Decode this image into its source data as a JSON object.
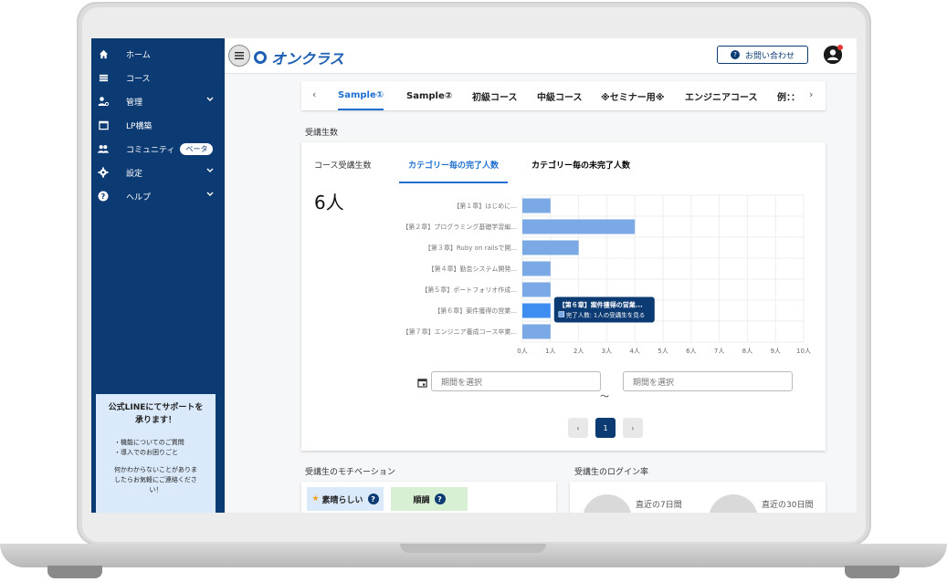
{
  "sidebar": {
    "items": [
      {
        "label": "ホーム",
        "icon": "home-icon",
        "has_chevron": false
      },
      {
        "label": "コース",
        "icon": "list-icon",
        "has_chevron": false
      },
      {
        "label": "管理",
        "icon": "user-gear-icon",
        "has_chevron": true
      },
      {
        "label": "LP構築",
        "icon": "window-icon",
        "has_chevron": false
      },
      {
        "label": "コミュニティ",
        "icon": "group-icon",
        "has_chevron": false,
        "badge": "ベータ"
      },
      {
        "label": "設定",
        "icon": "gear-icon",
        "has_chevron": true
      },
      {
        "label": "ヘルプ",
        "icon": "help-icon",
        "has_chevron": true
      }
    ],
    "support": {
      "title_line1": "公式LINEにてサポートを",
      "title_line2": "承ります！",
      "bullets": [
        "・機能についてのご質問",
        "・導入でのお困りごと"
      ],
      "note_line1": "何かわからないことがありま",
      "note_line2": "したらお気軽にご連絡くださ",
      "note_line3": "い！"
    }
  },
  "header": {
    "logo_text": "オンクラス",
    "contact_label": "お問い合わせ"
  },
  "course_tabs": [
    {
      "label": "Sample①",
      "active": true
    },
    {
      "label": "Sample②",
      "active": false
    },
    {
      "label": "初級コース",
      "active": false
    },
    {
      "label": "中級コース",
      "active": false
    },
    {
      "label": "※セミナー用※",
      "active": false
    },
    {
      "label": "エンジニアコース",
      "active": false
    },
    {
      "label": "例：：",
      "active": false
    }
  ],
  "main": {
    "section_title": "受講生数",
    "card_label": "コース受講生数",
    "total_count": "6人",
    "chart_tabs": [
      {
        "label": "カテゴリー毎の完了人数",
        "active": true
      },
      {
        "label": "カテゴリー毎の未完了人数",
        "active": false
      }
    ],
    "date_placeholder_start": "期間を選択",
    "date_placeholder_end": "期間を選択",
    "tilde": "〜",
    "pagination": {
      "prev": "‹",
      "current": "1",
      "next": "›"
    }
  },
  "chart_data": {
    "type": "bar",
    "orientation": "horizontal",
    "categories": [
      "【第１章】はじめに...",
      "【第２章】プログラミング基礎学習編...",
      "【第３章】Ruby on railsで開...",
      "【第４章】勤怠システム開発...",
      "【第５章】ポートフォリオ作成...",
      "【第６章】案件獲得の営業...",
      "【第７章】エンジニア養成コース卒業..."
    ],
    "values": [
      1,
      4,
      2,
      1,
      1,
      1,
      1
    ],
    "x_ticks": [
      "0人",
      "1人",
      "2人",
      "3人",
      "4人",
      "5人",
      "6人",
      "7人",
      "8人",
      "9人",
      "10人"
    ],
    "xlim": [
      0,
      10
    ],
    "grid": true,
    "bar_color": "#7aa9e6",
    "highlight_color": "#3d8ef0",
    "tooltip": {
      "index": 5,
      "title": "【第６章】案件獲得の営業...",
      "body": "完了人数: 1人の受講生を見る"
    }
  },
  "bottom": {
    "motivation_title": "受講生のモチベーション",
    "motivation_chips": [
      "素晴らしい",
      "順調"
    ],
    "login_title": "受講生のログイン率",
    "login_periods": [
      "直近の7日間",
      "直近の30日間"
    ]
  },
  "colors": {
    "sidebar_bg": "#0c3a73",
    "accent": "#1e6fd0",
    "chip_blue": "#dbeafa",
    "chip_green": "#d7f0d3"
  }
}
